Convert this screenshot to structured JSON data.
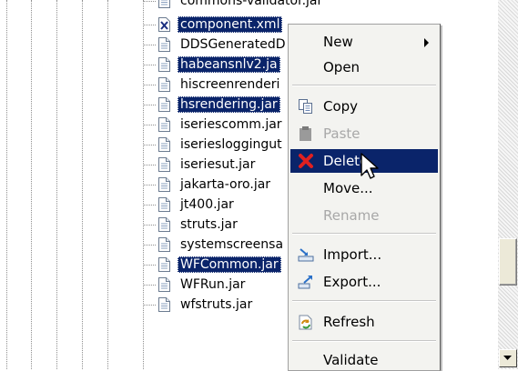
{
  "tree": {
    "items": [
      {
        "label": "commons-validator.jar",
        "selected": false,
        "icon": "jar-file-icon"
      },
      {
        "label": "component.xml",
        "selected": true,
        "icon": "xml-file-icon"
      },
      {
        "label": "DDSGeneratedD",
        "selected": false,
        "icon": "jar-file-icon"
      },
      {
        "label": "habeansnlv2.ja",
        "selected": true,
        "icon": "jar-file-icon"
      },
      {
        "label": "hiscreenrenderi",
        "selected": false,
        "icon": "jar-file-icon"
      },
      {
        "label": "hsrendering.jar",
        "selected": true,
        "icon": "jar-file-icon"
      },
      {
        "label": "iseriescomm.jar",
        "selected": false,
        "icon": "jar-file-icon"
      },
      {
        "label": "iseriesloggingut",
        "selected": false,
        "icon": "jar-file-icon"
      },
      {
        "label": "iseriesut.jar",
        "selected": false,
        "icon": "jar-file-icon"
      },
      {
        "label": "jakarta-oro.jar",
        "selected": false,
        "icon": "jar-file-icon"
      },
      {
        "label": "jt400.jar",
        "selected": false,
        "icon": "jar-file-icon"
      },
      {
        "label": "struts.jar",
        "selected": false,
        "icon": "jar-file-icon"
      },
      {
        "label": "systemscreensa",
        "selected": false,
        "icon": "jar-file-icon"
      },
      {
        "label": "WFCommon.jar",
        "selected": true,
        "icon": "jar-file-icon"
      },
      {
        "label": "WFRun.jar",
        "selected": false,
        "icon": "jar-file-icon"
      },
      {
        "label": "wfstruts.jar",
        "selected": false,
        "icon": "jar-file-icon"
      }
    ]
  },
  "menu": {
    "new": {
      "label": "New",
      "enabled": true,
      "submenu": true
    },
    "open": {
      "label": "Open",
      "enabled": true
    },
    "copy": {
      "label": "Copy",
      "enabled": true,
      "icon": "copy-icon"
    },
    "paste": {
      "label": "Paste",
      "enabled": false,
      "icon": "paste-icon"
    },
    "delete": {
      "label": "Delete",
      "enabled": true,
      "highlighted": true,
      "icon": "delete-icon"
    },
    "move": {
      "label": "Move...",
      "enabled": true
    },
    "rename": {
      "label": "Rename",
      "enabled": false
    },
    "import": {
      "label": "Import...",
      "enabled": true,
      "icon": "import-icon"
    },
    "export": {
      "label": "Export...",
      "enabled": true,
      "icon": "export-icon"
    },
    "refresh": {
      "label": "Refresh",
      "enabled": true,
      "icon": "refresh-icon"
    },
    "validate": {
      "label": "Validate",
      "enabled": true
    }
  },
  "colors": {
    "selection": "#0a246a",
    "menu_background": "#f3f3f0",
    "disabled_text": "#a8a8a8",
    "delete_icon": "#e02020"
  }
}
